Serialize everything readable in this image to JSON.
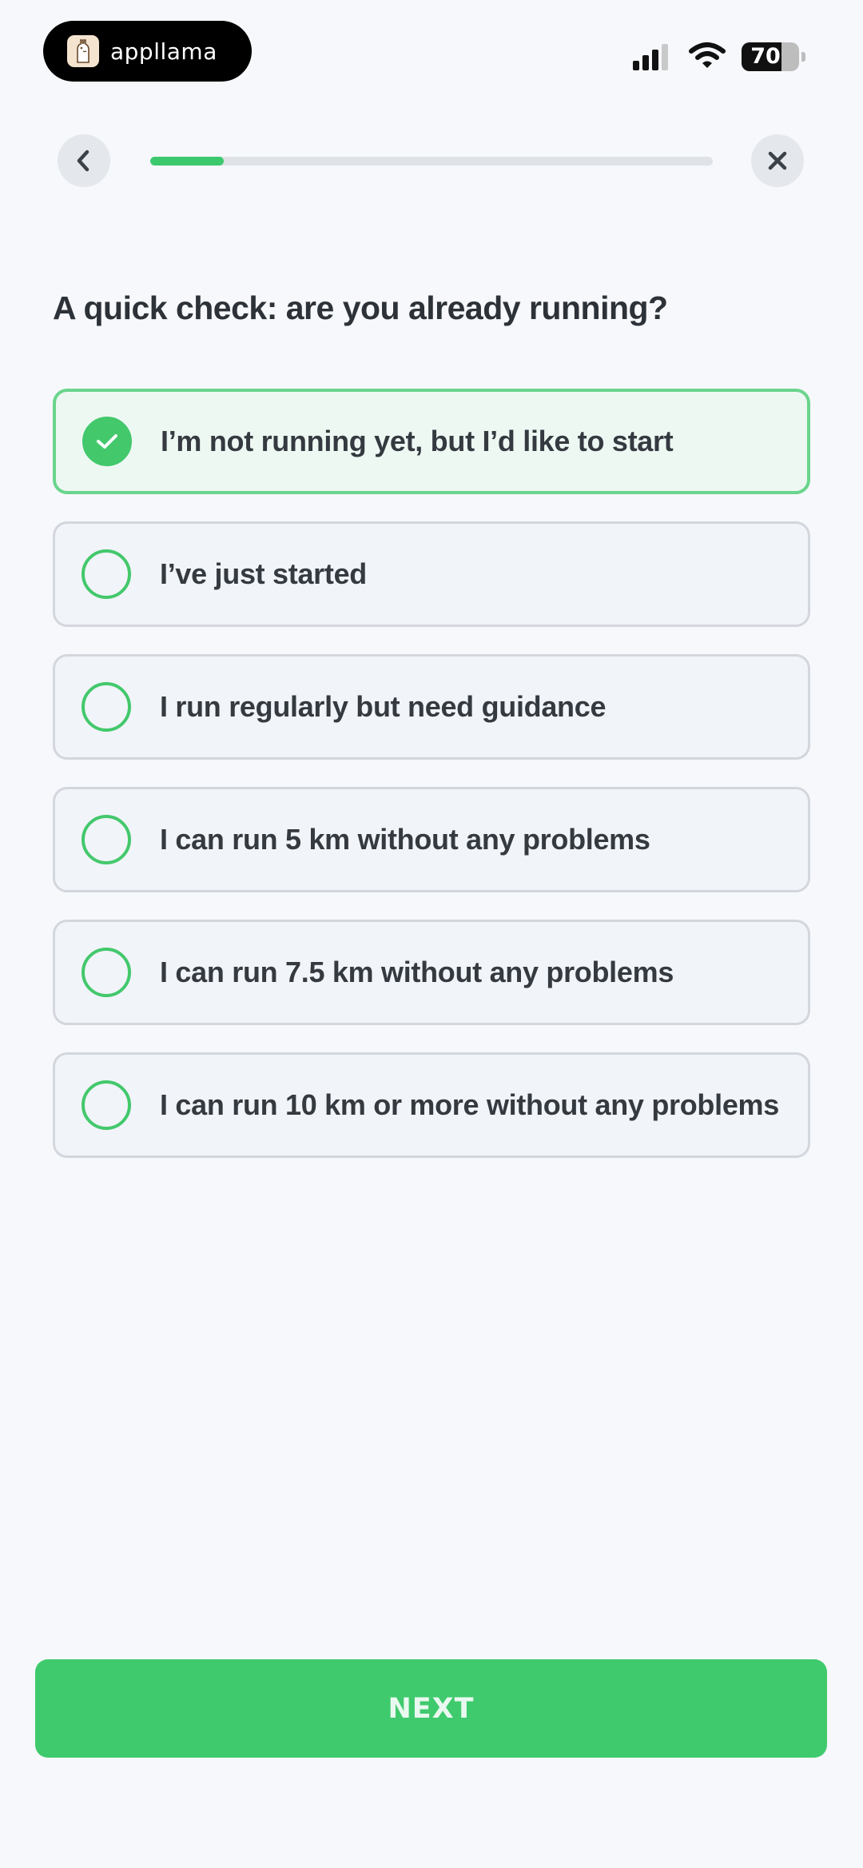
{
  "status_bar": {
    "brand_name": "appllama",
    "battery_level": 70,
    "battery_text": "70",
    "signal_bars_active": 3,
    "signal_bars_total": 4,
    "icons": [
      "appllama-logo-icon",
      "signal-icon",
      "wifi-icon",
      "battery-icon"
    ]
  },
  "header": {
    "back_icon": "chevron-left-icon",
    "close_icon": "close-icon",
    "progress_fraction": 0.13
  },
  "question": {
    "title": "A quick check: are you already running?"
  },
  "options": [
    {
      "label": "I’m not running yet, but I’d like to start",
      "selected": true
    },
    {
      "label": "I’ve just started",
      "selected": false
    },
    {
      "label": "I run regularly but need guidance",
      "selected": false
    },
    {
      "label": "I can run 5 km without any problems",
      "selected": false
    },
    {
      "label": "I can run 7.5 km without any problems",
      "selected": false
    },
    {
      "label": "I can run 10 km or more without any problems",
      "selected": false
    }
  ],
  "footer": {
    "next_label": "NEXT"
  },
  "colors": {
    "accent": "#3fca6d",
    "selected_border": "#6ad58c",
    "selected_background": "#eef8f3",
    "background": "#f6f8fb",
    "text": "#2d3339"
  }
}
